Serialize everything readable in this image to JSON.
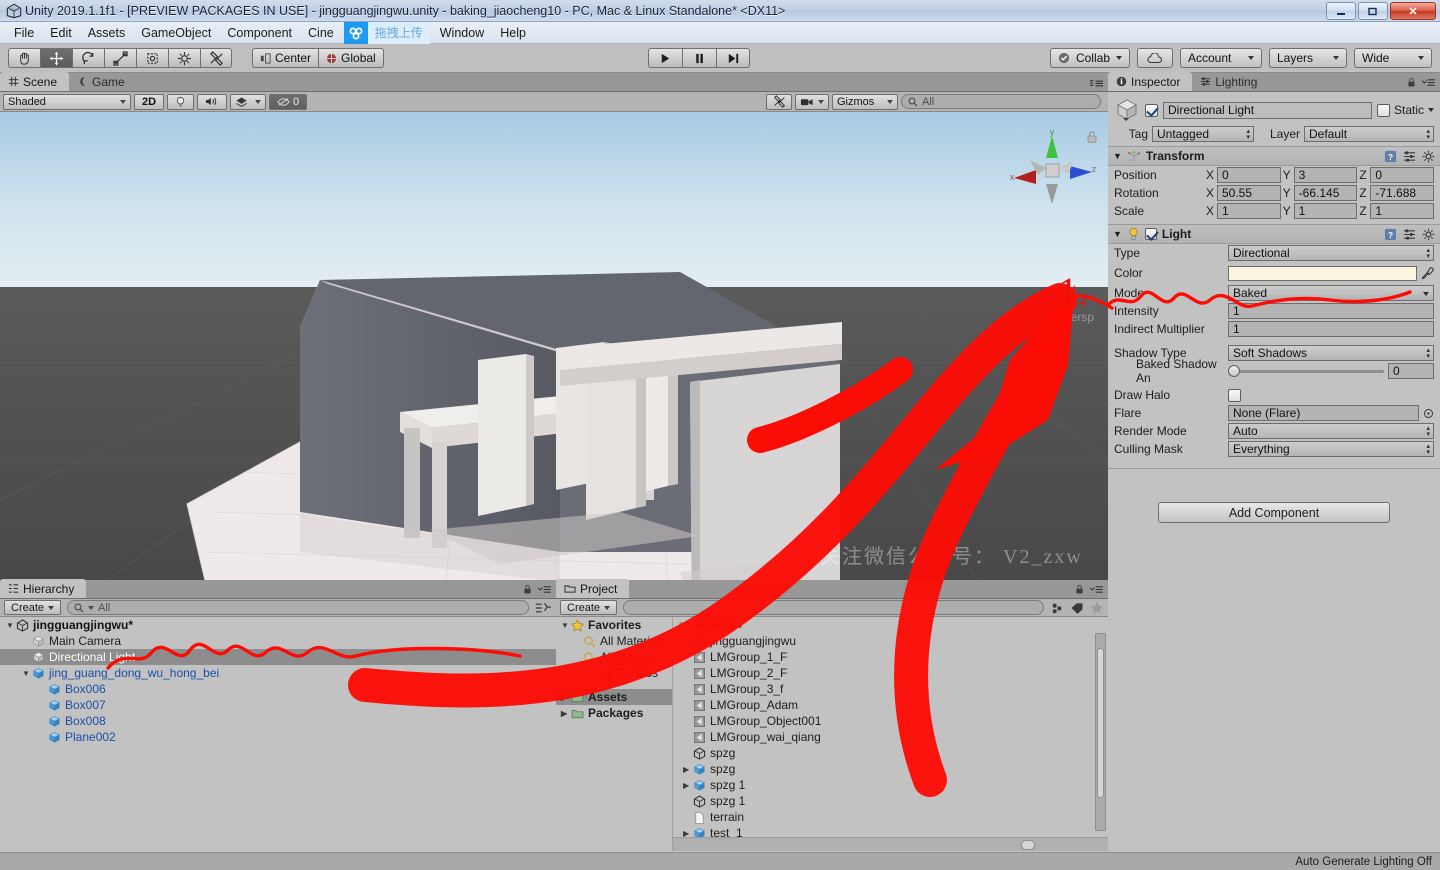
{
  "window": {
    "title": "Unity 2019.1.1f1 - [PREVIEW PACKAGES IN USE] - jingguangjingwu.unity - baking_jiaocheng10 - PC, Mac & Linux Standalone* <DX11>",
    "minimize_label": "–",
    "maximize_label": "❐",
    "close_label": "✕"
  },
  "menubar": {
    "items": [
      "File",
      "Edit",
      "Assets",
      "GameObject",
      "Component",
      "Cine"
    ],
    "items_right": [
      "Window",
      "Help"
    ],
    "collab_upload_label": "拖拽上传"
  },
  "toolbar": {
    "tools": [
      "hand-tool",
      "move-tool",
      "rotate-tool",
      "scale-tool",
      "rect-tool",
      "transform-tool",
      "custom-tool"
    ],
    "active_tool_index": 1,
    "pivot_label": "Center",
    "handle_label": "Global",
    "play_label": "▶",
    "pause_label": "❙❙",
    "step_label": "▶❙",
    "collab_label": "Collab",
    "cloud_label": "",
    "account_label": "Account",
    "layers_label": "Layers",
    "layout_label": "Wide"
  },
  "scene": {
    "tabs": [
      {
        "label": "Scene",
        "icon": "grid-icon",
        "active": true
      },
      {
        "label": "Game",
        "icon": "gamepad-icon",
        "active": false
      }
    ],
    "draw_mode": "Shaded",
    "mode_2d": "2D",
    "hidden_count": "0",
    "gizmos_label": "Gizmos",
    "search_placeholder": "All",
    "search_value": "",
    "persp_label": "Persp",
    "gizmo_axes": [
      "x",
      "y",
      "z"
    ],
    "watermark": "关注微信公众号： V2_zxw"
  },
  "hierarchy": {
    "tab_label": "Hierarchy",
    "create_label": "Create",
    "search_placeholder": "All",
    "search_value": "",
    "items": [
      {
        "label": "jingguangjingwu*",
        "depth": 0,
        "type": "scene",
        "expanded": true,
        "selected": false
      },
      {
        "label": "Main Camera",
        "depth": 1,
        "type": "gameobject",
        "expanded": false,
        "selected": false
      },
      {
        "label": "Directional Light",
        "depth": 1,
        "type": "gameobject",
        "expanded": false,
        "selected": true
      },
      {
        "label": "jing_guang_dong_wu_hong_bei",
        "depth": 1,
        "type": "prefab",
        "expanded": true,
        "selected": false
      },
      {
        "label": "Box006",
        "depth": 2,
        "type": "prefab",
        "expanded": false,
        "selected": false
      },
      {
        "label": "Box007",
        "depth": 2,
        "type": "prefab",
        "expanded": false,
        "selected": false
      },
      {
        "label": "Box008",
        "depth": 2,
        "type": "prefab",
        "expanded": false,
        "selected": false
      },
      {
        "label": "Plane002",
        "depth": 2,
        "type": "prefab",
        "expanded": false,
        "selected": false
      }
    ]
  },
  "project": {
    "tab_label": "Project",
    "create_label": "Create",
    "search_placeholder": "",
    "search_value": "",
    "favorites": [
      {
        "label": "Favorites",
        "depth": 0,
        "type": "star",
        "expanded": true,
        "bold": true
      },
      {
        "label": "All Materials",
        "depth": 1,
        "type": "search",
        "expanded": false,
        "bold": false
      },
      {
        "label": "All Models",
        "depth": 1,
        "type": "search",
        "expanded": false,
        "bold": false
      },
      {
        "label": "All Prefabs",
        "depth": 1,
        "type": "search",
        "expanded": false,
        "bold": false
      },
      {
        "label": "Assets",
        "depth": 0,
        "type": "folder",
        "expanded": false,
        "bold": true,
        "selected": true
      },
      {
        "label": "Packages",
        "depth": 0,
        "type": "folder",
        "expanded": false,
        "bold": true
      }
    ],
    "breadcrumb": "Assets",
    "files": [
      {
        "label": "jingguangjingwu",
        "type": "scene-asset",
        "arrow": false
      },
      {
        "label": "LMGroup_1_F",
        "type": "lightmap-asset",
        "arrow": false
      },
      {
        "label": "LMGroup_2_F",
        "type": "lightmap-asset",
        "arrow": false
      },
      {
        "label": "LMGroup_3_f",
        "type": "lightmap-asset",
        "arrow": false
      },
      {
        "label": "LMGroup_Adam",
        "type": "lightmap-asset",
        "arrow": false
      },
      {
        "label": "LMGroup_Object001",
        "type": "lightmap-asset",
        "arrow": false
      },
      {
        "label": "LMGroup_wai_qiang",
        "type": "lightmap-asset",
        "arrow": false
      },
      {
        "label": "spzg",
        "type": "scene-asset",
        "arrow": false
      },
      {
        "label": "spzg",
        "type": "prefab-asset",
        "arrow": true
      },
      {
        "label": "spzg 1",
        "type": "prefab-asset",
        "arrow": true
      },
      {
        "label": "spzg 1",
        "type": "scene-asset",
        "arrow": false
      },
      {
        "label": "terrain",
        "type": "text-asset",
        "arrow": false
      },
      {
        "label": "test_1",
        "type": "prefab-asset",
        "arrow": true
      }
    ]
  },
  "inspector": {
    "tabs": [
      {
        "label": "Inspector",
        "icon": "info-icon",
        "active": true
      },
      {
        "label": "Lighting",
        "icon": "lighting-icon",
        "active": false
      }
    ],
    "object_name": "Directional Light",
    "object_enabled": true,
    "static_label": "Static",
    "static_checked": false,
    "tag_label": "Tag",
    "tag_value": "Untagged",
    "layer_label": "Layer",
    "layer_value": "Default",
    "transform": {
      "title": "Transform",
      "rows": [
        {
          "label": "Position",
          "x": "0",
          "y": "3",
          "z": "0"
        },
        {
          "label": "Rotation",
          "x": "50.55",
          "y": "-66.145",
          "z": "-71.688"
        },
        {
          "label": "Scale",
          "x": "1",
          "y": "1",
          "z": "1"
        }
      ],
      "axis_labels": [
        "X",
        "Y",
        "Z"
      ]
    },
    "light": {
      "title": "Light",
      "enabled": true,
      "type_label": "Type",
      "type_value": "Directional",
      "color_label": "Color",
      "color_value": "#fbf5e0",
      "mode_label": "Mode",
      "mode_value": "Baked",
      "intensity_label": "Intensity",
      "intensity_value": "1",
      "indirect_label": "Indirect Multiplier",
      "indirect_value": "1",
      "shadow_type_label": "Shadow Type",
      "shadow_type_value": "Soft Shadows",
      "baked_shadow_label": "Baked Shadow An",
      "baked_shadow_value": "0",
      "draw_halo_label": "Draw Halo",
      "draw_halo_checked": false,
      "flare_label": "Flare",
      "flare_value": "None (Flare)",
      "render_mode_label": "Render Mode",
      "render_mode_value": "Auto",
      "culling_mask_label": "Culling Mask",
      "culling_mask_value": "Everything"
    },
    "add_component_label": "Add Component"
  },
  "statusbar": {
    "message": "Auto Generate Lighting Off"
  },
  "annotation": {
    "step_number": "1.",
    "color": "#e8100d"
  }
}
